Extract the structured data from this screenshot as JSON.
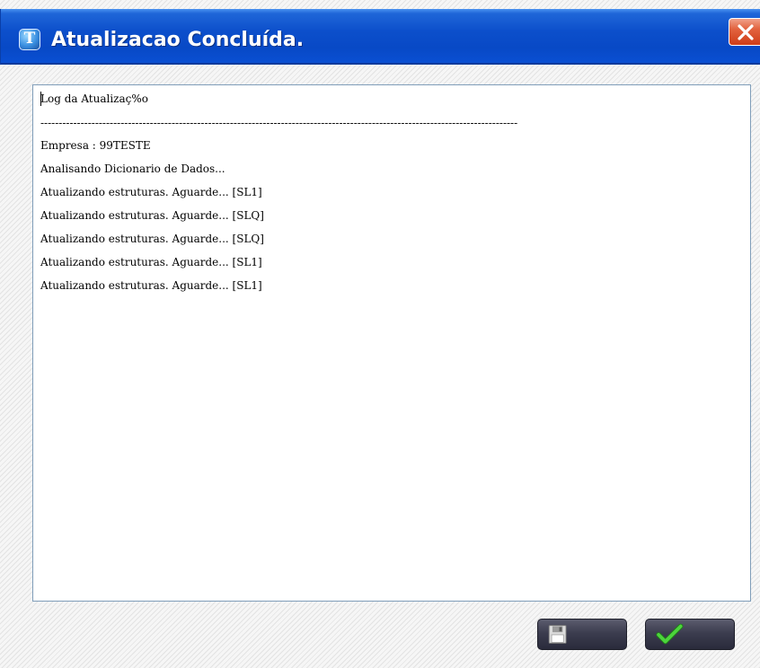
{
  "window": {
    "title": "Atualizacao Concluída.",
    "app_icon_glyph": "T",
    "icon_name": "app-icon"
  },
  "controls": {
    "close_icon": "close-icon",
    "save_icon": "floppy-disk-icon",
    "ok_icon": "checkmark-icon"
  },
  "log": {
    "header": "Log da Atualizaç%o",
    "separator": "-----------------------------------------------------------------------------------------------------------------------------------",
    "lines": [
      "Empresa : 99TESTE",
      "Analisando Dicionario de Dados...",
      "Atualizando estruturas. Aguarde... [SL1]",
      "Atualizando estruturas. Aguarde... [SLQ]",
      "Atualizando estruturas. Aguarde... [SLQ]",
      "Atualizando estruturas. Aguarde... [SL1]",
      "Atualizando estruturas. Aguarde... [SL1]"
    ]
  },
  "colors": {
    "titlebar": "#0c4fcb",
    "close": "#e2623e",
    "button": "#3c3d4f",
    "check": "#4cd43c"
  }
}
